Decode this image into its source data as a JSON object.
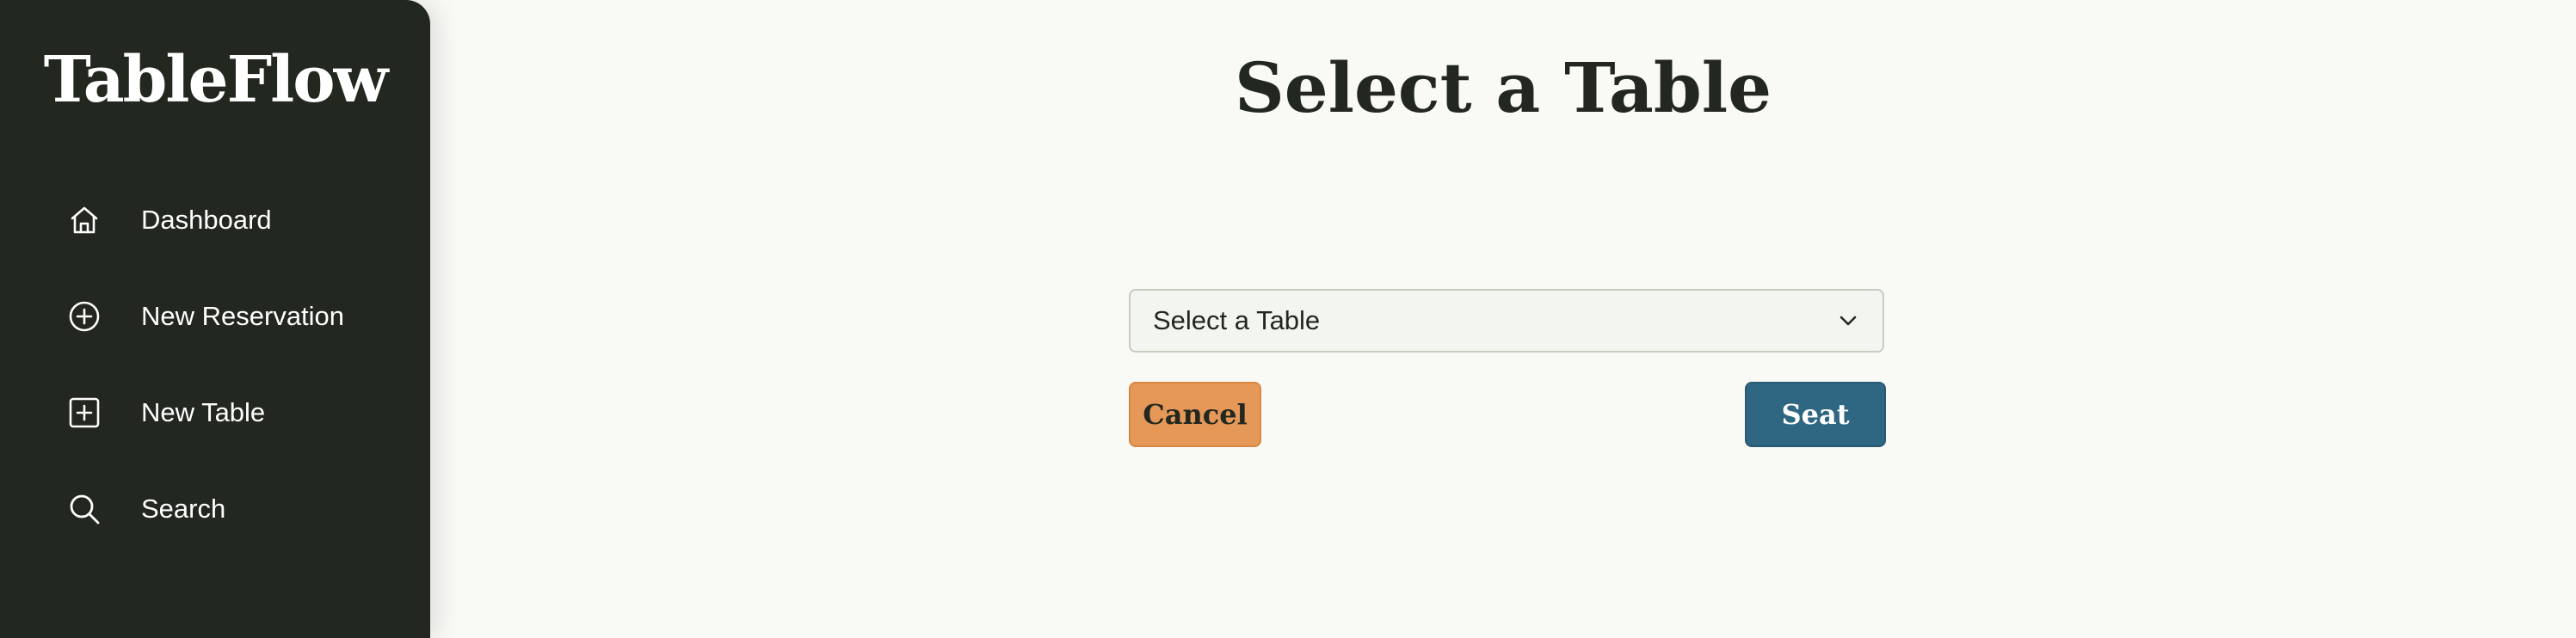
{
  "sidebar": {
    "brand": "TableFlow",
    "items": [
      {
        "label": "Dashboard",
        "icon": "home-icon"
      },
      {
        "label": "New Reservation",
        "icon": "plus-circle-icon"
      },
      {
        "label": "New Table",
        "icon": "plus-square-icon"
      },
      {
        "label": "Search",
        "icon": "search-icon"
      }
    ]
  },
  "main": {
    "title": "Select a Table",
    "select": {
      "value": "Select a Table"
    },
    "cancel_label": "Cancel",
    "seat_label": "Seat"
  },
  "colors": {
    "sidebar_bg": "#22271f",
    "page_bg": "#f9f9f6",
    "cancel_bg": "#e59858",
    "seat_bg": "#2f6682"
  }
}
